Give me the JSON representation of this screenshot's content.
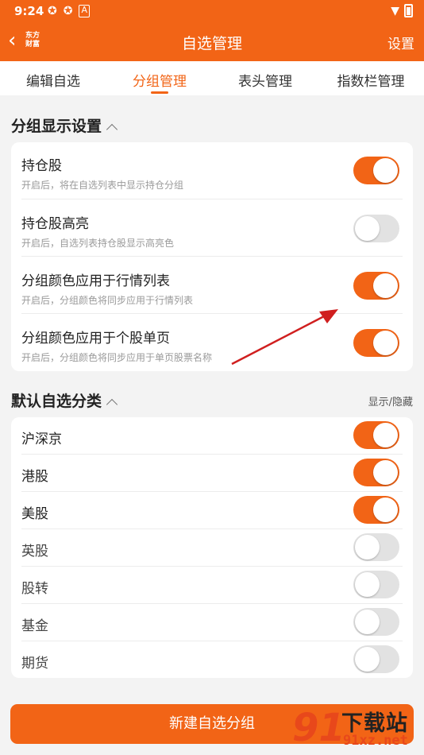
{
  "status_bar": {
    "time": "9:24",
    "icons": [
      "app-icon-1",
      "app-icon-2",
      "notification-a-icon"
    ],
    "right_icons": [
      "wifi-icon",
      "battery-icon"
    ]
  },
  "nav": {
    "logo_line1": "东方",
    "logo_line2": "财富",
    "title": "自选管理",
    "settings": "设置"
  },
  "tabs": [
    {
      "label": "编辑自选"
    },
    {
      "label": "分组管理"
    },
    {
      "label": "表头管理"
    },
    {
      "label": "指数栏管理"
    }
  ],
  "active_tab_index": 1,
  "group_display": {
    "title": "分组显示设置",
    "items": [
      {
        "label": "持仓股",
        "desc": "开启后，将在自选列表中显示持仓分组",
        "on": true
      },
      {
        "label": "持仓股高亮",
        "desc": "开启后，自选列表持仓股显示高亮色",
        "on": false
      },
      {
        "label": "分组颜色应用于行情列表",
        "desc": "开启后，分组颜色将同步应用于行情列表",
        "on": true
      },
      {
        "label": "分组颜色应用于个股单页",
        "desc": "开启后，分组颜色将同步应用于单页股票名称",
        "on": true
      }
    ]
  },
  "default_categories": {
    "title": "默认自选分类",
    "side_label": "显示/隐藏",
    "items": [
      {
        "label": "沪深京",
        "on": true
      },
      {
        "label": "港股",
        "on": true
      },
      {
        "label": "美股",
        "on": true
      },
      {
        "label": "英股",
        "on": false
      },
      {
        "label": "股转",
        "on": false
      },
      {
        "label": "基金",
        "on": false
      },
      {
        "label": "期货",
        "on": false
      }
    ]
  },
  "new_group_button": "新建自选分组",
  "watermark": {
    "num": "91",
    "cn": "下载站",
    "url": "91xz.net"
  },
  "colors": {
    "accent": "#f26416",
    "toggle_off": "#e2e2e2",
    "annotation_arrow": "#d01f1f"
  }
}
